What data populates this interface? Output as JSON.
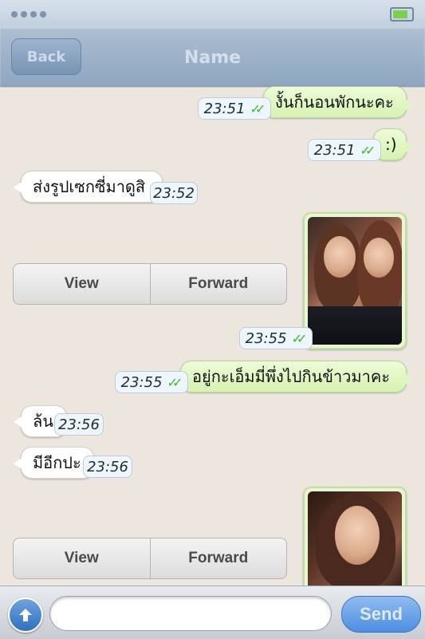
{
  "header": {
    "back_label": "Back",
    "title": "Name"
  },
  "messages": [
    {
      "dir": "out",
      "text": "งั้นก็นอนพักนะคะ",
      "time": "23:51",
      "ticks": "✓✓"
    },
    {
      "dir": "out",
      "text": ":)",
      "time": "23:51",
      "ticks": "✓✓"
    },
    {
      "dir": "in",
      "text": "ส่งรูปเซกซี่มาดูสิ",
      "time": "23:52"
    },
    {
      "dir": "out",
      "type": "photo",
      "time": "23:55",
      "ticks": "✓✓"
    },
    {
      "dir": "out",
      "text": "อยู่กะเอ็มมี่พึ่งไปกินข้าวมาคะ",
      "time": "23:55",
      "ticks": "✓✓"
    },
    {
      "dir": "in",
      "text": "ล้น",
      "time": "23:56"
    },
    {
      "dir": "in",
      "text": "มีอีกปะ",
      "time": "23:56"
    },
    {
      "dir": "out",
      "type": "photo"
    }
  ],
  "media_actions": {
    "view_label": "View",
    "forward_label": "Forward"
  },
  "input": {
    "placeholder": "",
    "send_label": "Send"
  },
  "colors": {
    "outgoing_bubble": "#dff5c4",
    "incoming_bubble": "#ffffff",
    "read_ticks": "#3dbb2f",
    "send_button": "#4d8de0"
  }
}
